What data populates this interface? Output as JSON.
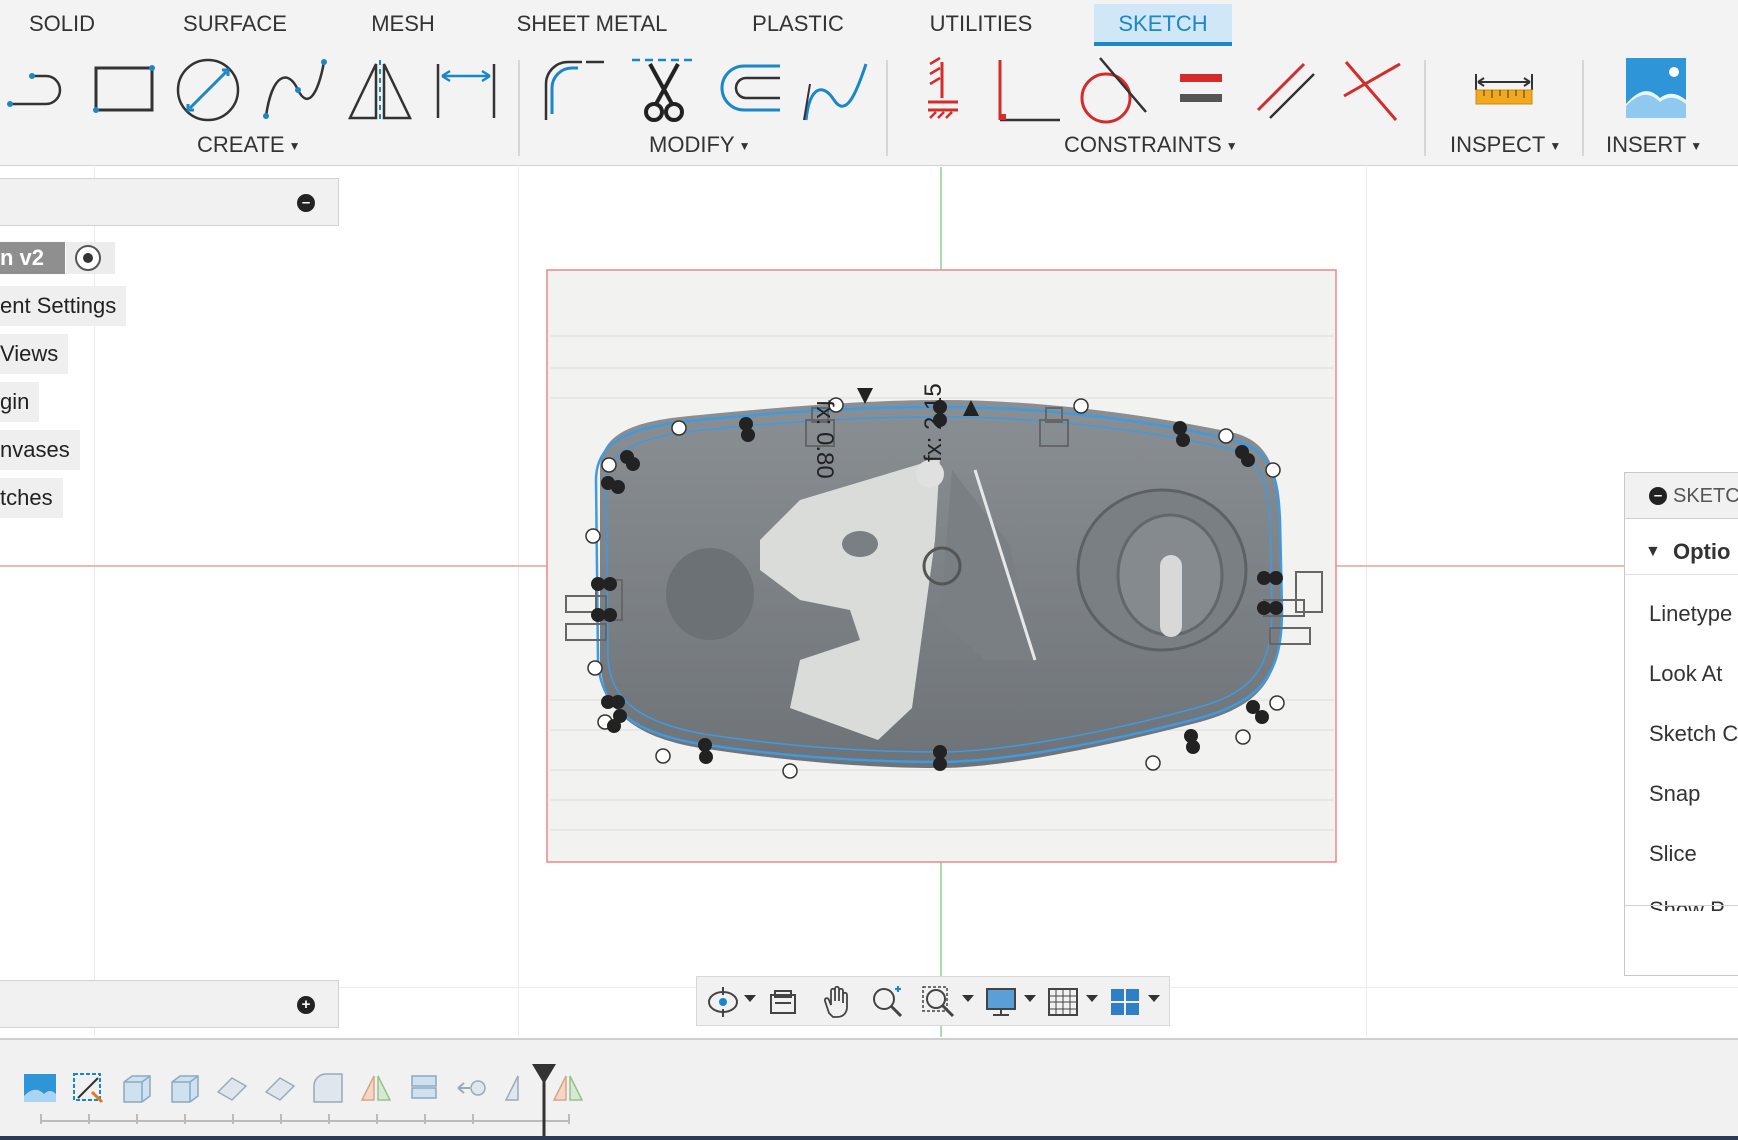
{
  "tabs": [
    {
      "label": "SOLID"
    },
    {
      "label": "SURFACE"
    },
    {
      "label": "MESH"
    },
    {
      "label": "SHEET METAL"
    },
    {
      "label": "PLASTIC"
    },
    {
      "label": "UTILITIES"
    },
    {
      "label": "SKETCH",
      "active": true
    }
  ],
  "toolbar_groups": {
    "create": "CREATE",
    "modify": "MODIFY",
    "constraints": "CONSTRAINTS",
    "inspect": "INSPECT",
    "insert": "INSERT"
  },
  "tools": {
    "create": [
      "slot-icon",
      "rectangle-icon",
      "circle-icon",
      "spline-icon",
      "mirror-icon",
      "dimension-icon"
    ],
    "modify": [
      "fillet-icon",
      "trim-icon",
      "offset-icon",
      "spline-edit-icon"
    ],
    "constraints": [
      "fix-constraint-icon",
      "perpendicular-constraint-icon",
      "tangent-constraint-icon",
      "equal-constraint-icon",
      "parallel-constraint-icon",
      "angle-constraint-icon"
    ],
    "inspect": [
      "measure-icon"
    ],
    "insert": [
      "insert-image-icon"
    ]
  },
  "browser": {
    "document_node": "n v2",
    "items": [
      "ent Settings",
      "Views",
      "gin",
      "nvases",
      "tches"
    ]
  },
  "sketch_dimensions": {
    "dim1": "fx: 0.80",
    "dim2": "fx: 2.15"
  },
  "palette": {
    "title": "SKETC",
    "section": "Optio",
    "options": [
      "Linetype",
      "Look At",
      "Sketch C",
      "Snap",
      "Slice",
      "Show P"
    ]
  },
  "colors": {
    "accent": "#1a87c9",
    "active_tab_bg": "#cfe7f6",
    "constraint_red": "#d42b2b",
    "sketch_blue": "#3f9ae0",
    "canvas_frame": "#e88a8a"
  },
  "navbar": [
    "orbit-icon",
    "look-at-icon",
    "pan-icon",
    "zoom-icon",
    "zoom-window-icon",
    "display-settings-icon",
    "grid-settings-icon",
    "viewports-icon"
  ],
  "timeline": [
    "canvas-image-icon",
    "sketch-icon",
    "extrude-icon",
    "extrude-icon",
    "shell-icon",
    "shell-icon",
    "fillet-icon",
    "mirror-icon",
    "combine-icon",
    "move-icon",
    "mirror-icon",
    "mirror-icon"
  ]
}
